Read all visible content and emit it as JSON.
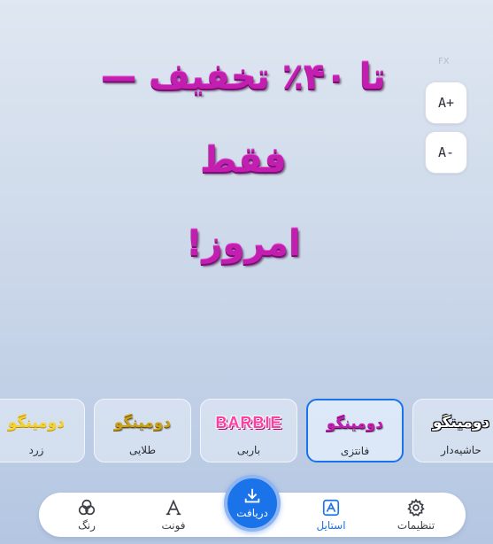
{
  "headline": {
    "line1": "تا ۴۰٪ تخفیف — فقط",
    "line2": "امروز!"
  },
  "fx_label": "FX",
  "size_controls": {
    "increase": "A+",
    "decrease": "A-"
  },
  "styles": [
    {
      "sample": "دومینگو",
      "label": "زرد"
    },
    {
      "sample": "دومینگو",
      "label": "طلایی"
    },
    {
      "sample": "BARBIE",
      "label": "باربی"
    },
    {
      "sample": "دومینگو",
      "label": "فانتزی",
      "selected": true
    },
    {
      "sample": "دومینگو",
      "label": "حاشیه‌دار"
    }
  ],
  "bottom_nav": {
    "color": "رنگ",
    "font": "فونت",
    "download": "دریافت",
    "style": "استایل",
    "settings": "تنظیمات"
  },
  "colors": {
    "accent": "#1a73e8",
    "headline": "#c21fb0"
  }
}
